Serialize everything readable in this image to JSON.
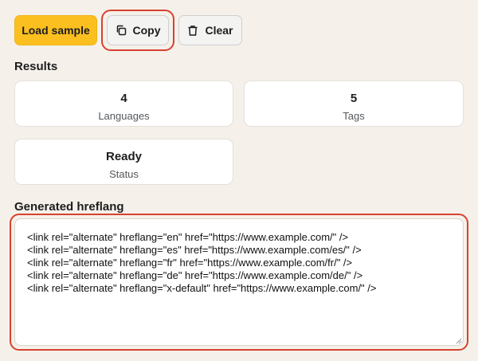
{
  "toolbar": {
    "load_label": "Load sample",
    "copy_label": "Copy",
    "clear_label": "Clear"
  },
  "results": {
    "heading": "Results",
    "cards": [
      {
        "value": "4",
        "label": "Languages"
      },
      {
        "value": "5",
        "label": "Tags"
      },
      {
        "value": "Ready",
        "label": "Status"
      }
    ]
  },
  "output": {
    "heading": "Generated hreflang",
    "text": "<link rel=\"alternate\" hreflang=\"en\" href=\"https://www.example.com/\" />\n<link rel=\"alternate\" hreflang=\"es\" href=\"https://www.example.com/es/\" />\n<link rel=\"alternate\" hreflang=\"fr\" href=\"https://www.example.com/fr/\" />\n<link rel=\"alternate\" hreflang=\"de\" href=\"https://www.example.com/de/\" />\n<link rel=\"alternate\" hreflang=\"x-default\" href=\"https://www.example.com/\" />"
  },
  "colors": {
    "primary": "#fbbf1f",
    "highlight": "#d9412f",
    "background": "#f5f1ea"
  },
  "icons": {
    "copy": "copy-icon",
    "clear": "trash-icon"
  }
}
